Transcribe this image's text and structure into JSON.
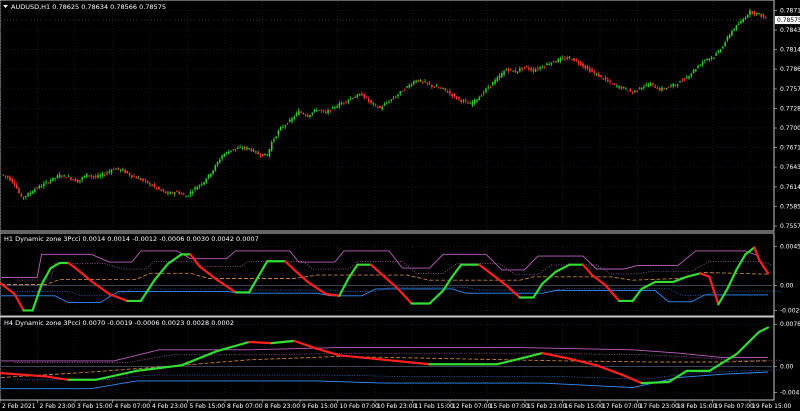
{
  "colors": {
    "background": "#000000",
    "grid": "#1c2a3a",
    "border": "#c8c8c8",
    "bull": "#33cc33",
    "bear": "#ff3b30",
    "indicator_up": "#33dd33",
    "indicator_down": "#ff2020",
    "upper_band": "#c060c0",
    "lower_band": "#2f8fff",
    "mid_dashed": "#c08040",
    "aux_dotted": "#d070d0",
    "aux_dotted2": "#4090ff"
  },
  "chart_data": [
    {
      "type": "candlestick",
      "title": "AUDUSD,H1  0.78625 0.78634 0.78566 0.78575",
      "symbol": "AUDUSD,H1",
      "ohlc": {
        "open": 0.78625,
        "high": 0.78634,
        "low": 0.78566,
        "close": 0.78575
      },
      "current_price_label": "0.78575",
      "yticks": [
        "0.78715",
        "0.78430",
        "0.78145",
        "0.77860",
        "0.77570",
        "0.77285",
        "0.77000",
        "0.76715",
        "0.76430",
        "0.76140",
        "0.75855",
        "0.75570"
      ],
      "ylim": [
        0.7557,
        0.7878
      ],
      "path_points": [
        [
          0,
          0.7632
        ],
        [
          3,
          0.7628
        ],
        [
          6,
          0.7619
        ],
        [
          9,
          0.7598
        ],
        [
          12,
          0.7603
        ],
        [
          15,
          0.7611
        ],
        [
          18,
          0.7616
        ],
        [
          22,
          0.7624
        ],
        [
          26,
          0.7631
        ],
        [
          30,
          0.7628
        ],
        [
          34,
          0.7622
        ],
        [
          38,
          0.7632
        ],
        [
          42,
          0.7628
        ],
        [
          46,
          0.7633
        ],
        [
          50,
          0.7641
        ],
        [
          54,
          0.7638
        ],
        [
          58,
          0.763
        ],
        [
          62,
          0.7625
        ],
        [
          66,
          0.7618
        ],
        [
          70,
          0.761
        ],
        [
          74,
          0.7604
        ],
        [
          78,
          0.7607
        ],
        [
          82,
          0.76
        ],
        [
          86,
          0.7612
        ],
        [
          90,
          0.7622
        ],
        [
          94,
          0.7639
        ],
        [
          98,
          0.766
        ],
        [
          102,
          0.7668
        ],
        [
          106,
          0.7671
        ],
        [
          110,
          0.767
        ],
        [
          114,
          0.7662
        ],
        [
          118,
          0.766
        ],
        [
          120,
          0.7679
        ],
        [
          124,
          0.77
        ],
        [
          128,
          0.771
        ],
        [
          132,
          0.7724
        ],
        [
          136,
          0.7718
        ],
        [
          140,
          0.7727
        ],
        [
          144,
          0.7722
        ],
        [
          148,
          0.7731
        ],
        [
          152,
          0.7738
        ],
        [
          156,
          0.7745
        ],
        [
          160,
          0.7749
        ],
        [
          164,
          0.7736
        ],
        [
          168,
          0.7729
        ],
        [
          172,
          0.7739
        ],
        [
          176,
          0.7749
        ],
        [
          180,
          0.776
        ],
        [
          184,
          0.777
        ],
        [
          188,
          0.7766
        ],
        [
          192,
          0.776
        ],
        [
          196,
          0.7757
        ],
        [
          200,
          0.7748
        ],
        [
          204,
          0.774
        ],
        [
          208,
          0.7735
        ],
        [
          212,
          0.7745
        ],
        [
          216,
          0.776
        ],
        [
          220,
          0.7772
        ],
        [
          224,
          0.7786
        ],
        [
          228,
          0.7782
        ],
        [
          232,
          0.7789
        ],
        [
          236,
          0.7784
        ],
        [
          240,
          0.779
        ],
        [
          244,
          0.7796
        ],
        [
          248,
          0.78
        ],
        [
          252,
          0.7802
        ],
        [
          256,
          0.7796
        ],
        [
          260,
          0.7786
        ],
        [
          264,
          0.7778
        ],
        [
          268,
          0.777
        ],
        [
          272,
          0.7762
        ],
        [
          276,
          0.7758
        ],
        [
          280,
          0.7752
        ],
        [
          284,
          0.776
        ],
        [
          288,
          0.7764
        ],
        [
          292,
          0.7756
        ],
        [
          296,
          0.776
        ],
        [
          300,
          0.7765
        ],
        [
          304,
          0.7774
        ],
        [
          308,
          0.7787
        ],
        [
          312,
          0.78
        ],
        [
          316,
          0.7804
        ],
        [
          320,
          0.782
        ],
        [
          324,
          0.7842
        ],
        [
          328,
          0.7855
        ],
        [
          332,
          0.787
        ],
        [
          336,
          0.7866
        ],
        [
          340,
          0.7858
        ]
      ]
    },
    {
      "type": "line",
      "title": "H1 Dynamic zone 3Pcci  0.0014 0.0014 -0.0012 -0.0006 0.0030 0.0042 0.0007",
      "yticks": [
        "0.0045",
        "0.00",
        "-0.0029"
      ],
      "ylim": [
        -0.0032,
        0.0048
      ],
      "upper_band": [
        [
          0,
          0.0009
        ],
        [
          16,
          0.0009
        ],
        [
          18,
          0.0036
        ],
        [
          40,
          0.0036
        ],
        [
          48,
          0.0027
        ],
        [
          58,
          0.0027
        ],
        [
          62,
          0.004
        ],
        [
          78,
          0.004
        ],
        [
          84,
          0.0031
        ],
        [
          100,
          0.0031
        ],
        [
          104,
          0.004
        ],
        [
          128,
          0.004
        ],
        [
          132,
          0.0027
        ],
        [
          148,
          0.0027
        ],
        [
          152,
          0.004
        ],
        [
          172,
          0.004
        ],
        [
          178,
          0.002
        ],
        [
          190,
          0.002
        ],
        [
          196,
          0.0036
        ],
        [
          215,
          0.0036
        ],
        [
          222,
          0.0018
        ],
        [
          232,
          0.0018
        ],
        [
          238,
          0.0034
        ],
        [
          258,
          0.0034
        ],
        [
          264,
          0.0019
        ],
        [
          276,
          0.0019
        ],
        [
          282,
          0.0023
        ],
        [
          300,
          0.0023
        ],
        [
          308,
          0.004
        ],
        [
          330,
          0.004
        ],
        [
          336,
          0.0034
        ]
      ],
      "lower_band": [
        [
          0,
          -0.0012
        ],
        [
          24,
          -0.0012
        ],
        [
          30,
          -0.002
        ],
        [
          44,
          -0.002
        ],
        [
          52,
          -0.0007
        ],
        [
          100,
          -0.0007
        ],
        [
          106,
          -0.0009
        ],
        [
          140,
          -0.0009
        ],
        [
          146,
          -0.0012
        ],
        [
          160,
          -0.0012
        ],
        [
          166,
          -0.0004
        ],
        [
          200,
          -0.0004
        ],
        [
          206,
          -0.0009
        ],
        [
          240,
          -0.0009
        ],
        [
          246,
          -0.0006
        ],
        [
          290,
          -0.0006
        ],
        [
          296,
          -0.0019
        ],
        [
          306,
          -0.0019
        ],
        [
          312,
          -0.0011
        ],
        [
          340,
          -0.0011
        ]
      ],
      "mid_dashed": [
        [
          0,
          0.0001
        ],
        [
          20,
          0.0001
        ],
        [
          26,
          0.0007
        ],
        [
          60,
          0.0007
        ],
        [
          66,
          0.0014
        ],
        [
          84,
          0.0014
        ],
        [
          92,
          0.0008
        ],
        [
          130,
          0.0008
        ],
        [
          140,
          0.0012
        ],
        [
          180,
          0.0012
        ],
        [
          190,
          0.0006
        ],
        [
          230,
          0.0006
        ],
        [
          236,
          0.001
        ],
        [
          270,
          0.001
        ],
        [
          280,
          0.0006
        ],
        [
          300,
          0.0008
        ],
        [
          312,
          0.0015
        ],
        [
          340,
          0.0013
        ]
      ],
      "signal": [
        [
          0,
          0.0002
        ],
        [
          6,
          -0.001
        ],
        [
          10,
          -0.0029
        ],
        [
          14,
          -0.0029
        ],
        [
          18,
          0.0001
        ],
        [
          22,
          0.002
        ],
        [
          26,
          0.0026
        ],
        [
          30,
          0.0026
        ],
        [
          34,
          0.0018
        ],
        [
          40,
          0.0005
        ],
        [
          48,
          -0.001
        ],
        [
          56,
          -0.0018
        ],
        [
          62,
          -0.0018
        ],
        [
          68,
          0.0006
        ],
        [
          74,
          0.0025
        ],
        [
          80,
          0.0036
        ],
        [
          84,
          0.0036
        ],
        [
          88,
          0.0022
        ],
        [
          96,
          0.0006
        ],
        [
          104,
          -0.0008
        ],
        [
          110,
          -0.0008
        ],
        [
          114,
          0.001
        ],
        [
          118,
          0.0028
        ],
        [
          126,
          0.0028
        ],
        [
          130,
          0.0018
        ],
        [
          136,
          0.0004
        ],
        [
          144,
          -0.001
        ],
        [
          150,
          -0.0012
        ],
        [
          154,
          0.0008
        ],
        [
          158,
          0.0024
        ],
        [
          164,
          0.0024
        ],
        [
          170,
          0.001
        ],
        [
          176,
          -0.0004
        ],
        [
          182,
          -0.0021
        ],
        [
          190,
          -0.0021
        ],
        [
          196,
          -0.0006
        ],
        [
          200,
          0.001
        ],
        [
          204,
          0.0024
        ],
        [
          212,
          0.0024
        ],
        [
          218,
          0.0012
        ],
        [
          224,
          0.0
        ],
        [
          230,
          -0.0014
        ],
        [
          236,
          -0.0014
        ],
        [
          240,
          0.0002
        ],
        [
          246,
          0.0016
        ],
        [
          252,
          0.0024
        ],
        [
          258,
          0.0024
        ],
        [
          262,
          0.0012
        ],
        [
          268,
          0.0
        ],
        [
          274,
          -0.0018
        ],
        [
          280,
          -0.0018
        ],
        [
          284,
          -0.0004
        ],
        [
          290,
          0.0004
        ],
        [
          298,
          0.0004
        ],
        [
          304,
          0.001
        ],
        [
          310,
          0.0014
        ],
        [
          314,
          0.001
        ],
        [
          318,
          -0.0022
        ],
        [
          322,
          -0.0004
        ],
        [
          326,
          0.0018
        ],
        [
          330,
          0.0036
        ],
        [
          334,
          0.0044
        ],
        [
          336,
          0.003
        ],
        [
          340,
          0.0014
        ]
      ]
    },
    {
      "type": "line",
      "title": "H4 Dynamic zone 3Pcci  0.0070 -0.0019 -0.0006 0.0023 0.0028 0.0002",
      "yticks": [
        "0.0076",
        "0.00",
        "-0.0047"
      ],
      "ylim": [
        -0.0055,
        0.008
      ],
      "upper_band": [
        [
          0,
          0.001
        ],
        [
          50,
          0.001
        ],
        [
          70,
          0.003
        ],
        [
          110,
          0.003
        ],
        [
          150,
          0.0034
        ],
        [
          230,
          0.0034
        ],
        [
          280,
          0.003
        ],
        [
          300,
          0.0024
        ],
        [
          320,
          0.0016
        ],
        [
          340,
          0.0016
        ]
      ],
      "lower_band": [
        [
          0,
          -0.004
        ],
        [
          40,
          -0.004
        ],
        [
          60,
          -0.0026
        ],
        [
          140,
          -0.0026
        ],
        [
          170,
          -0.003
        ],
        [
          240,
          -0.003
        ],
        [
          280,
          -0.0038
        ],
        [
          300,
          -0.002
        ],
        [
          320,
          -0.0014
        ],
        [
          340,
          -0.001
        ]
      ],
      "mid_dashed": [
        [
          0,
          -0.002
        ],
        [
          40,
          -0.001
        ],
        [
          80,
          0.0002
        ],
        [
          110,
          0.0012
        ],
        [
          150,
          0.0018
        ],
        [
          200,
          0.0014
        ],
        [
          250,
          0.001
        ],
        [
          290,
          0.0008
        ],
        [
          320,
          0.0008
        ],
        [
          340,
          0.001
        ]
      ],
      "signal": [
        [
          0,
          -0.0012
        ],
        [
          20,
          -0.0018
        ],
        [
          30,
          -0.0024
        ],
        [
          42,
          -0.0024
        ],
        [
          60,
          -0.0008
        ],
        [
          80,
          0.0002
        ],
        [
          96,
          0.0028
        ],
        [
          110,
          0.0044
        ],
        [
          120,
          0.0042
        ],
        [
          130,
          0.0046
        ],
        [
          140,
          0.0032
        ],
        [
          150,
          0.002
        ],
        [
          160,
          0.0016
        ],
        [
          190,
          0.0004
        ],
        [
          220,
          0.0004
        ],
        [
          240,
          0.0024
        ],
        [
          252,
          0.0014
        ],
        [
          264,
          0.0002
        ],
        [
          276,
          -0.0016
        ],
        [
          284,
          -0.003
        ],
        [
          296,
          -0.0028
        ],
        [
          304,
          -0.0008
        ],
        [
          314,
          -0.0008
        ],
        [
          326,
          0.0022
        ],
        [
          336,
          0.0062
        ],
        [
          340,
          0.007
        ]
      ]
    }
  ],
  "xaxis": {
    "labels": [
      "2 Feb 2021",
      "2 Feb 23:00",
      "3 Feb 15:00",
      "4 Feb 07:00",
      "4 Feb 23:00",
      "5 Feb 15:00",
      "8 Feb 07:00",
      "8 Feb 23:00",
      "9 Feb 15:00",
      "10 Feb 07:00",
      "10 Feb 23:00",
      "11 Feb 15:00",
      "12 Feb 07:00",
      "15 Feb 07:00",
      "15 Feb 23:00",
      "16 Feb 15:00",
      "17 Feb 07:00",
      "17 Feb 23:00",
      "18 Feb 15:00",
      "19 Feb 07:00",
      "19 Feb 15:00"
    ]
  }
}
